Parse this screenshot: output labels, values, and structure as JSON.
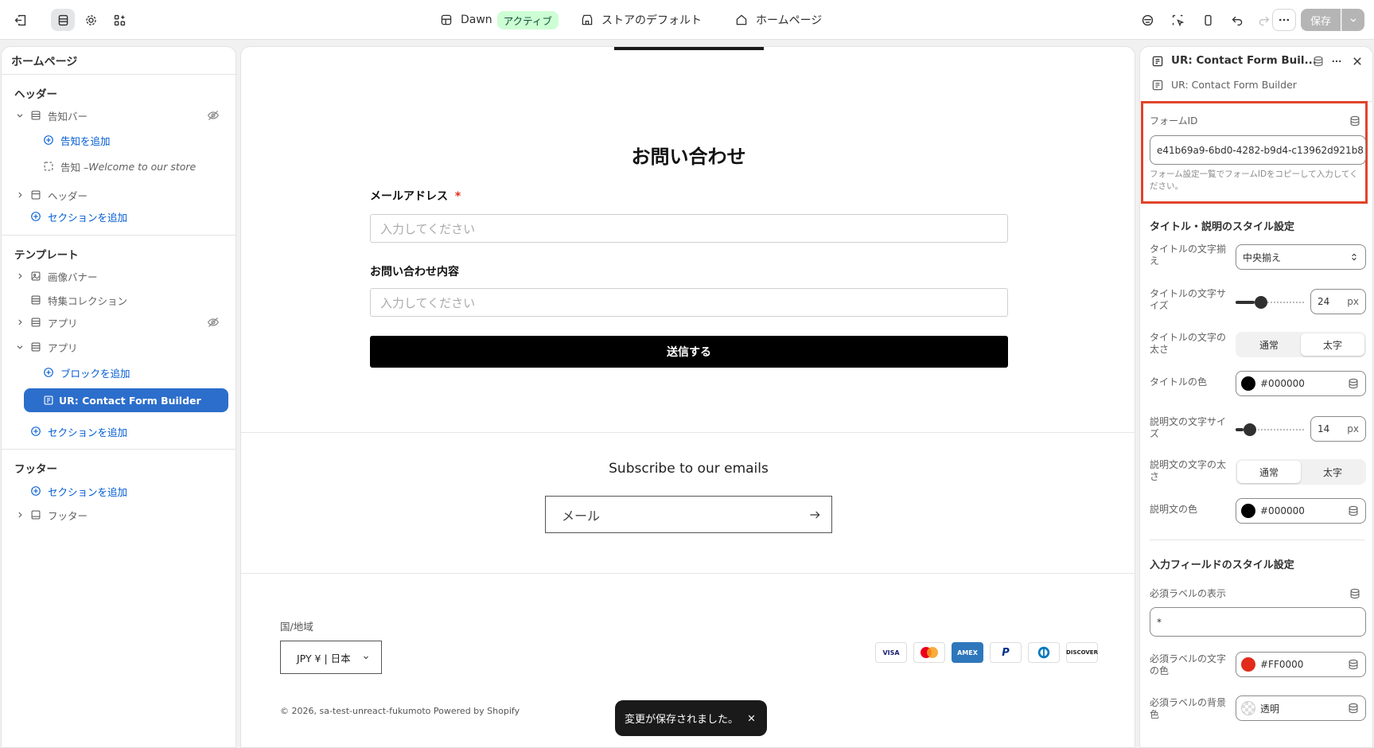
{
  "topbar": {
    "theme_name": "Dawn",
    "theme_status": "アクティブ",
    "store_default": "ストアのデフォルト",
    "page_select": "ホームページ",
    "save_label": "保存"
  },
  "left_panel": {
    "title": "ホームページ",
    "header_group": "ヘッダー",
    "announcement_bar": "告知バー",
    "add_announcement": "告知を追加",
    "announcement_item_prefix": "告知 – ",
    "announcement_item_text": "Welcome to our store",
    "header_section": "ヘッダー",
    "add_section_1": "セクションを追加",
    "template_group": "テンプレート",
    "image_banner": "画像バナー",
    "featured_collection": "特集コレクション",
    "app_1": "アプリ",
    "app_2": "アプリ",
    "add_block": "ブロックを追加",
    "selected_block": "UR: Contact Form Builder",
    "add_section_2": "セクションを追加",
    "footer_group": "フッター",
    "add_section_3": "セクションを追加",
    "footer_section": "フッター"
  },
  "preview": {
    "form_title": "お問い合わせ",
    "email_label": "メールアドレス",
    "required_mark": "*",
    "email_placeholder": "入力してください",
    "message_label": "お問い合わせ内容",
    "message_placeholder": "入力してください",
    "submit_label": "送信する",
    "subscribe_title": "Subscribe to our emails",
    "subscribe_placeholder": "メール",
    "region_label": "国/地域",
    "currency_select": "JPY ¥ | 日本",
    "copyright": "© 2026, sa-test-unreact-fukumoto Powered by Shopify",
    "payments": [
      "VISA",
      "MC",
      "AMEX",
      "PayPal",
      "Diners",
      "DISCOVER"
    ]
  },
  "right_panel": {
    "header_title": "UR: Contact Form Buil...",
    "subtitle": "UR: Contact Form Builder",
    "form_id_label": "フォームID",
    "form_id_value": "e41b69a9-6bd0-4282-b9d4-c13962d921b8",
    "form_id_help": "フォーム設定一覧でフォームIDをコピーして入力してください。",
    "title_style_section": "タイトル・説明のスタイル設定",
    "title_align_label": "タイトルの文字揃え",
    "title_align_value": "中央揃え",
    "title_size_label": "タイトルの文字サイズ",
    "title_size_value": "24",
    "title_size_fraction": 0.28,
    "unit_px": "px",
    "title_weight_label": "タイトルの文字の太さ",
    "weight_normal": "通常",
    "weight_bold": "太字",
    "title_color_label": "タイトルの色",
    "title_color_value": "#000000",
    "desc_size_label": "説明文の文字サイズ",
    "desc_size_value": "14",
    "desc_size_fraction": 0.12,
    "desc_weight_label": "説明文の文字の太さ",
    "desc_color_label": "説明文の色",
    "desc_color_value": "#000000",
    "input_style_section": "入力フィールドのスタイル設定",
    "required_display_label": "必須ラベルの表示",
    "required_display_value": "*",
    "required_color_label": "必須ラベルの文字の色",
    "required_color_value": "#FF0000",
    "required_bg_label": "必須ラベルの背景色",
    "required_bg_value": "透明"
  },
  "toast": {
    "message": "変更が保存されました。"
  },
  "colors": {
    "accent": "#2c6ecb",
    "highlight": "#e0442a",
    "required": "#e22b1b"
  }
}
